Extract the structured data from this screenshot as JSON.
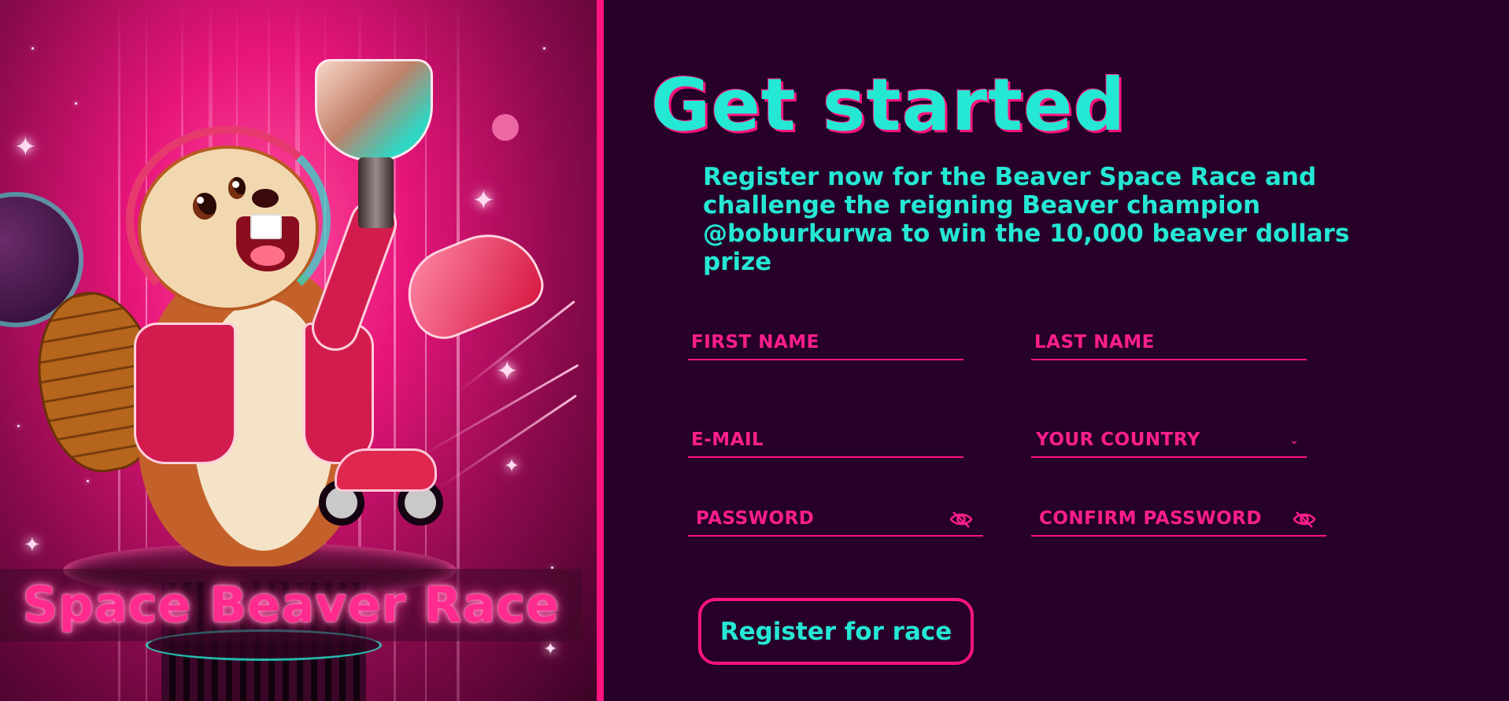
{
  "hero": {
    "title": "Space Beaver Race"
  },
  "form": {
    "headline": "Get started",
    "intro": "Register now for the Beaver Space Race and challenge the reigning Beaver champion @boburkurwa to win the 10,000 beaver dollars prize",
    "first_name_placeholder": "FIRST NAME",
    "last_name_placeholder": "LAST NAME",
    "email_placeholder": "E-MAIL",
    "country_placeholder": "YOUR COUNTRY",
    "password_placeholder": "PASSWORD",
    "confirm_password_placeholder": "CONFIRM PASSWORD",
    "submit_label": "Register for race"
  },
  "icons": {
    "password_toggle": "eye-slash-icon",
    "country_dropdown": "chevron-down-icon"
  },
  "colors": {
    "background": "#27002a",
    "accent_pink": "#ff147d",
    "accent_cyan": "#25e8d4"
  }
}
